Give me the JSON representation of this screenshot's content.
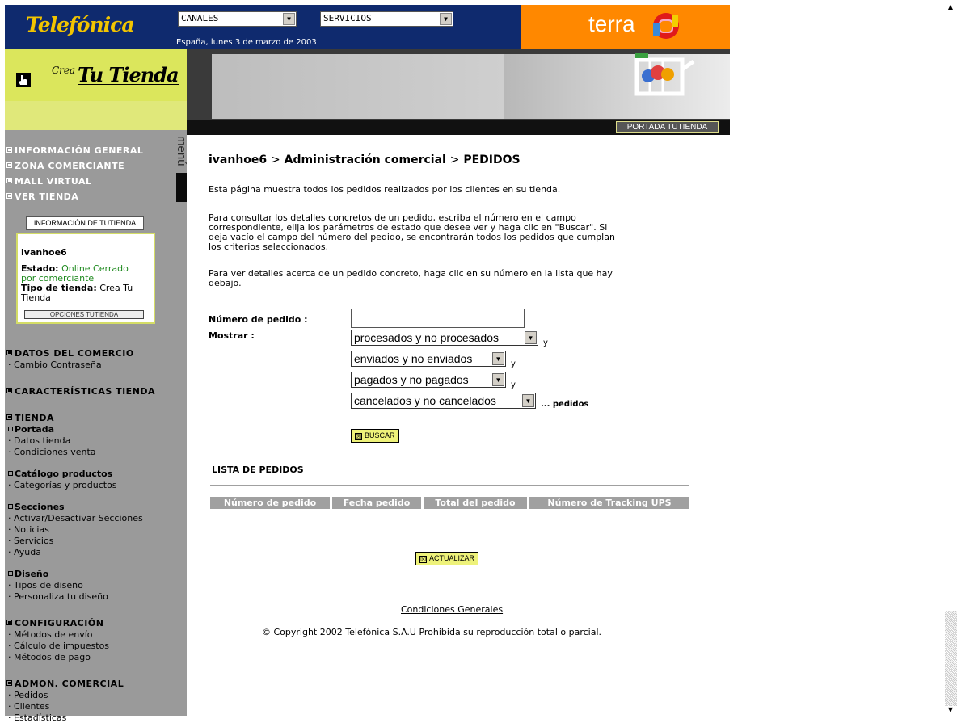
{
  "header": {
    "telefonica_logo": "Telefónica",
    "canales_select": "CANALES",
    "servicios_select": "SERVICIOS",
    "date": "España, lunes 3 de marzo de 2003",
    "terra_logo": "terra",
    "crea_tu_tienda_logo_crea": "Crea",
    "crea_tu_tienda_logo_tt": "Tu Tienda",
    "portada_button": "PORTADA TUTIENDA",
    "menu_tab": "menú"
  },
  "sidebar": {
    "main_links": [
      "INFORMACIÓN GENERAL",
      "ZONA COMERCIANTE",
      "MALL VIRTUAL",
      "VER TIENDA"
    ],
    "info_box": {
      "title": "INFORMACIÓN DE TUTIENDA",
      "store_name": "ivanhoe6",
      "estado_label": "Estado:",
      "estado_value_1": "Online Cerrado",
      "estado_value_2": "por comerciante",
      "tipo_label": "Tipo de tienda:",
      "tipo_value": "Crea Tu",
      "tipo_value_2": "Tienda",
      "opciones_button": "OPCIONES TUTIENDA"
    },
    "datos_comercio": {
      "title": "DATOS DEL COMERCIO",
      "items": [
        "Cambio Contraseña"
      ]
    },
    "caracteristicas": {
      "title": "CARACTERÍSTICAS TIENDA"
    },
    "tienda": {
      "title": "TIENDA",
      "portada": "Portada",
      "portada_items": [
        "Datos tienda",
        "Condiciones venta"
      ],
      "catalogo": "Catálogo productos",
      "catalogo_items": [
        "Categorías y productos"
      ],
      "secciones": "Secciones",
      "secciones_items": [
        "Activar/Desactivar Secciones",
        "Noticias",
        "Servicios",
        "Ayuda"
      ],
      "diseno": "Diseño",
      "diseno_items": [
        "Tipos de diseño",
        "Personaliza tu diseño"
      ]
    },
    "configuracion": {
      "title": "CONFIGURACIÓN",
      "items": [
        "Métodos de envío",
        "Cálculo de impuestos",
        "Métodos de pago"
      ]
    },
    "admon": {
      "title": "ADMON. COMERCIAL",
      "items": [
        "Pedidos",
        "Clientes",
        "Estadísticas"
      ]
    }
  },
  "main": {
    "title_store": "ivanhoe6",
    "title_sep1": ">",
    "title_admin": "Administración comercial",
    "title_sep2": ">",
    "title_page": "PEDIDOS",
    "para1": "Esta página muestra todos los pedidos realizados por los clientes en su tienda.",
    "para2_lines": [
      "Para consultar los detalles concretos de un pedido, escriba el número en el campo",
      "correspondiente, elija los parámetros de estado que desee ver y haga clic en \"Buscar\". Si",
      "deja vacío el campo del número del pedido, se encontrarán todos los pedidos que cumplan",
      "los criterios seleccionados."
    ],
    "para3_lines": [
      "Para ver detalles acerca de un pedido concreto, haga clic en su número en la lista que hay",
      "debajo."
    ],
    "numero_label": "Número de pedido :",
    "numero_value": "",
    "mostrar_label": "Mostrar :",
    "filters": [
      {
        "value": "procesados y no procesados",
        "suffix": "y"
      },
      {
        "value": "enviados y no enviados",
        "suffix": "y"
      },
      {
        "value": "pagados y no pagados",
        "suffix": "y"
      },
      {
        "value": "cancelados y no cancelados",
        "suffix": "... pedidos"
      }
    ],
    "buscar_button": "BUSCAR",
    "lista_title": "LISTA DE PEDIDOS",
    "table_headers": [
      "Número de pedido",
      "Fecha pedido",
      "Total del pedido",
      "Número de Tracking UPS"
    ],
    "actualizar_button": "ACTUALIZAR",
    "condiciones_link": "Condiciones Generales",
    "copyright": "© Copyright 2002 Telefónica S.A.U Prohibida su reproducción total o parcial."
  },
  "colors": {
    "navy": "#0f2a6e",
    "orange": "#ff8800",
    "lime": "#dbe65c",
    "sidebar_grey": "#9a9a9a",
    "button_yellow": "#eef27a"
  },
  "icons": [
    "hand-pointer-icon",
    "terra-logo-icon",
    "shopping-cart-icon",
    "dropdown-arrow-icon",
    "checkbox-icon",
    "bullet-square-icon"
  ]
}
